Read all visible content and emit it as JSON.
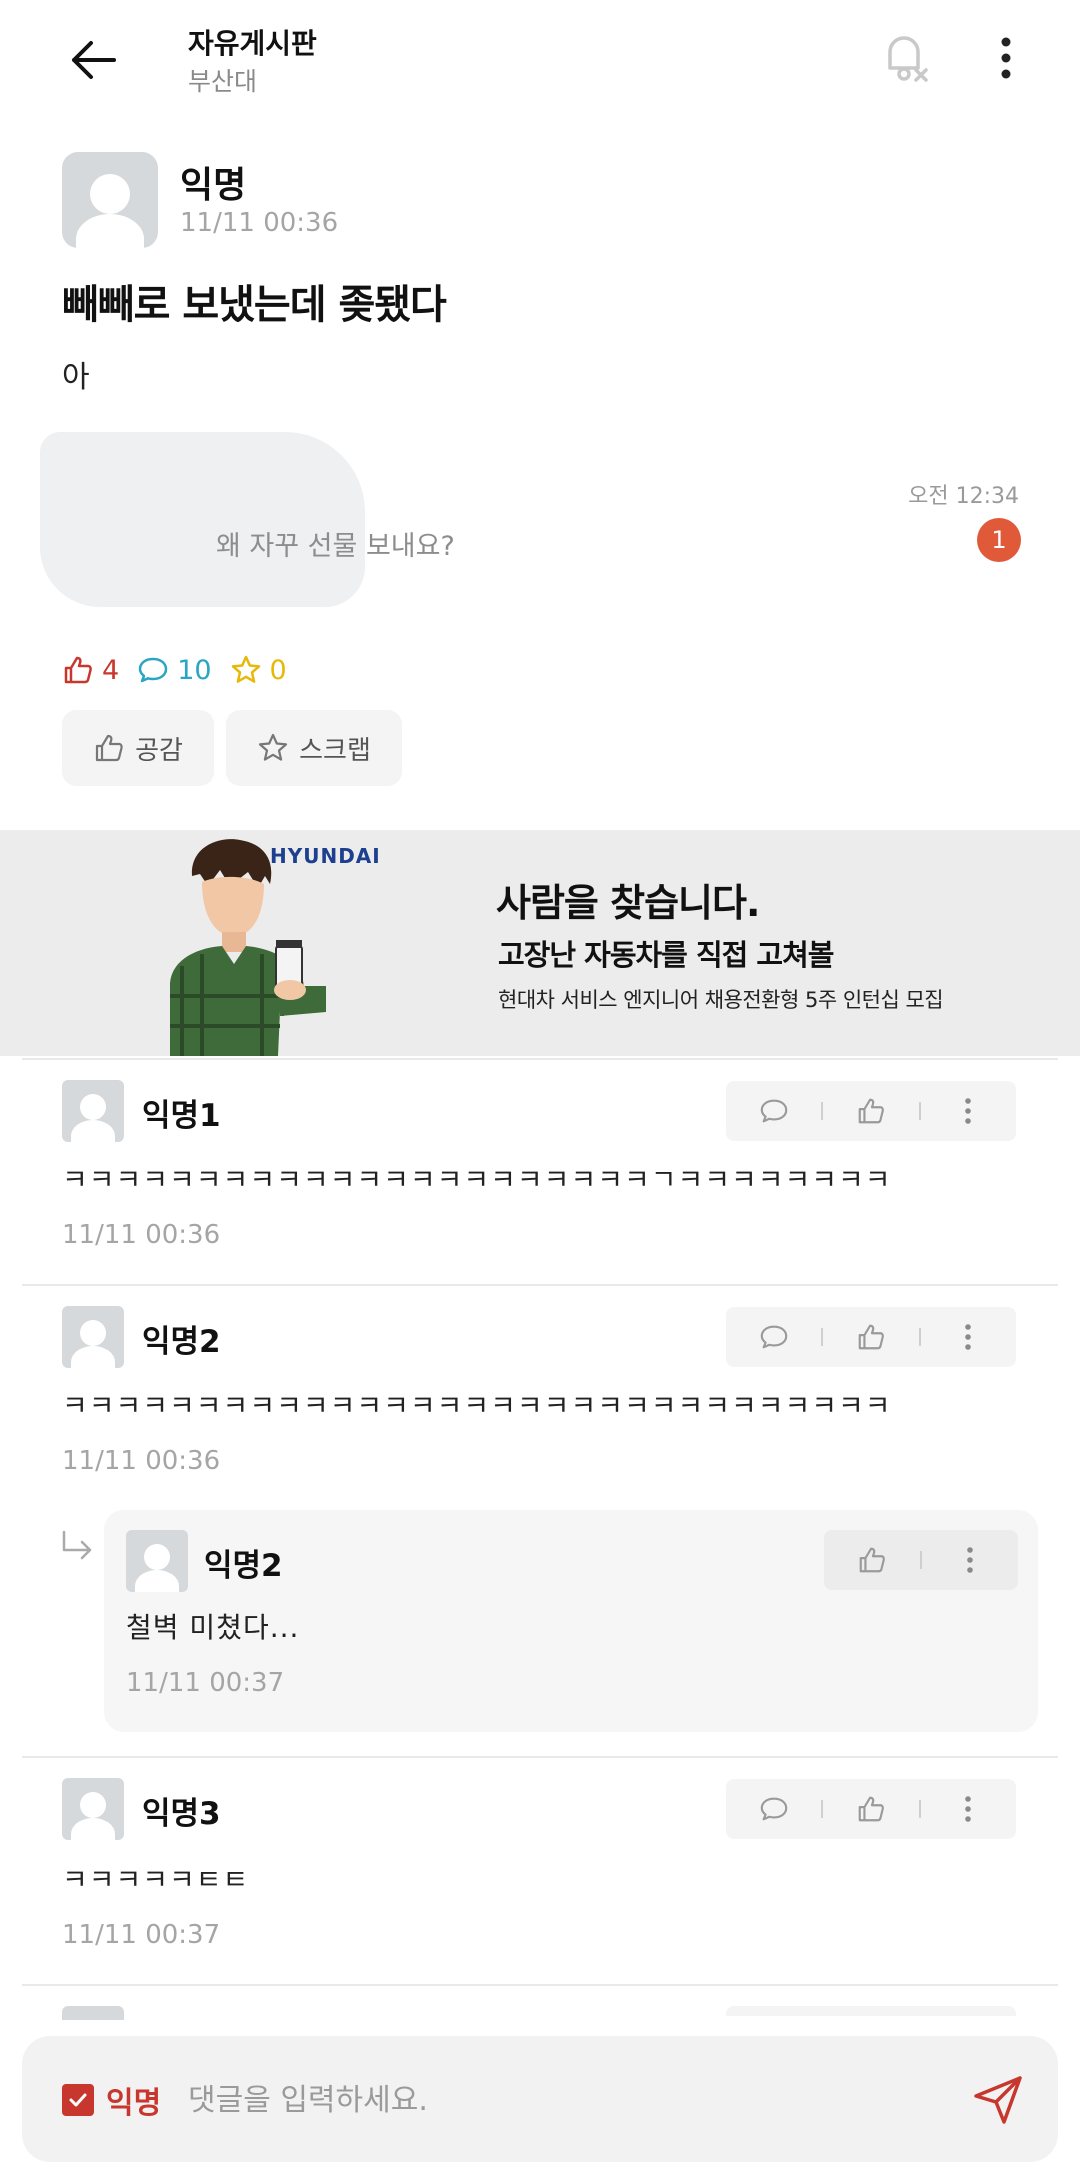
{
  "header": {
    "title": "자유게시판",
    "subtitle": "부산대"
  },
  "post": {
    "author": "익명",
    "time": "11/11 00:36",
    "title": "빼빼로 보냈는데 좆됐다",
    "body": "아",
    "image": {
      "time": "오전 12:34",
      "message": "왜 자꾸 선물 보내요?",
      "badge": "1"
    },
    "stats": {
      "likes": "4",
      "comments": "10",
      "scraps": "0"
    },
    "empathy_label": "공감",
    "scrap_label": "스크랩"
  },
  "ad": {
    "brand": "HYUNDAI",
    "headline": "사람을 찾습니다.",
    "subheadline": "고장난 자동차를 직접 고쳐볼",
    "detail": "현대차 서비스 엔지니어 채용전환형 5주 인턴십 모집"
  },
  "comments": [
    {
      "author": "익명1",
      "text": "ㅋㅋㅋㅋㅋㅋㅋㅋㅋㅋㅋㅋㅋㅋㅋㅋㅋㅋㅋㅋㅋㅋㄱㅋㅋㅋㅋㅋㅋㅋㅋ",
      "time": "11/11 00:36"
    },
    {
      "author": "익명2",
      "text": "ㅋㅋㅋㅋㅋㅋㅋㅋㅋㅋㅋㅋㅋㅋㅋㅋㅋㅋㅋㅋㅋㅋㅋㅋㅋㅋㅋㅋㅋㅋㅋ",
      "time": "11/11 00:36"
    },
    {
      "author": "익명3",
      "text": "ㅋㅋㅋㅋㅋㅌㅌ",
      "time": "11/11 00:37"
    }
  ],
  "reply": {
    "author": "익명2",
    "text": "철벽 미쳤다...",
    "time": "11/11 00:37"
  },
  "input": {
    "anon_label": "익명",
    "anon_checked": true,
    "placeholder": "댓글을 입력하세요."
  },
  "colors": {
    "accent": "#c8372d",
    "comment_stat": "#2aa5c4",
    "scrap_stat": "#e5b80a"
  }
}
